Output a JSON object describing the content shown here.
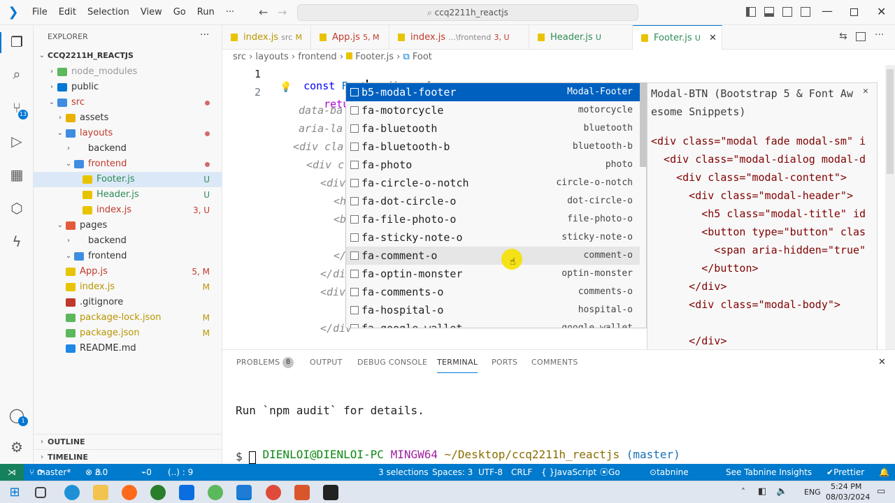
{
  "titlebar": {
    "menus": [
      "File",
      "Edit",
      "Selection",
      "View",
      "Go",
      "Run",
      "···"
    ],
    "search": "ccq2211h_reactjs"
  },
  "activity": {
    "source_control_badge": "13",
    "accounts_badge": "1"
  },
  "sidebar": {
    "header": "EXPLORER",
    "more": "···",
    "root": "CCQ2211H_REACTJS",
    "items": [
      {
        "label": "node_modules",
        "status": ""
      },
      {
        "label": "public",
        "status": ""
      },
      {
        "label": "src",
        "status": ""
      },
      {
        "label": "assets",
        "status": ""
      },
      {
        "label": "layouts",
        "status": ""
      },
      {
        "label": "backend",
        "status": ""
      },
      {
        "label": "frontend",
        "status": ""
      },
      {
        "label": "Footer.js",
        "status": "U"
      },
      {
        "label": "Header.js",
        "status": "U"
      },
      {
        "label": "index.js",
        "status": "3, U"
      },
      {
        "label": "pages",
        "status": ""
      },
      {
        "label": "backend",
        "status": ""
      },
      {
        "label": "frontend",
        "status": ""
      },
      {
        "label": "App.js",
        "status": "5, M"
      },
      {
        "label": "index.js",
        "status": "M"
      },
      {
        "label": ".gitignore",
        "status": ""
      },
      {
        "label": "package-lock.json",
        "status": "M"
      },
      {
        "label": "package.json",
        "status": "M"
      },
      {
        "label": "README.md",
        "status": ""
      }
    ],
    "outline": "OUTLINE",
    "timeline": "TIMELINE"
  },
  "tabs": [
    {
      "name": "index.js",
      "desc": "src",
      "status": "M"
    },
    {
      "name": "App.js",
      "desc": "",
      "status": "5, M"
    },
    {
      "name": "index.js",
      "desc": "...\\frontend",
      "status": "3, U"
    },
    {
      "name": "Header.js",
      "desc": "",
      "status": "U"
    },
    {
      "name": "Footer.js",
      "desc": "",
      "status": "U"
    }
  ],
  "breadcrumbs": [
    "src",
    "layouts",
    "frontend",
    "Footer.js",
    "Foot"
  ],
  "editor": {
    "line1_no": "1",
    "line2_no": "2",
    "line1_const": "const",
    "line1_name": "Foot",
    "line1_rest": " = () => {",
    "line2": "return",
    "ghost": [
      "data-ba",
      "aria-la",
      "<div cla",
      "<div c",
      "<div",
      "<h",
      "<b",
      "</",
      "</di",
      "<div",
      "</div"
    ]
  },
  "suggest": [
    {
      "name": "b5-modal-footer",
      "detail": "Modal-Footer"
    },
    {
      "name": "fa-motorcycle",
      "detail": "motorcycle"
    },
    {
      "name": "fa-bluetooth",
      "detail": "bluetooth"
    },
    {
      "name": "fa-bluetooth-b",
      "detail": "bluetooth-b"
    },
    {
      "name": "fa-photo",
      "detail": "photo"
    },
    {
      "name": "fa-circle-o-notch",
      "detail": "circle-o-notch"
    },
    {
      "name": "fa-dot-circle-o",
      "detail": "dot-circle-o"
    },
    {
      "name": "fa-file-photo-o",
      "detail": "file-photo-o"
    },
    {
      "name": "fa-sticky-note-o",
      "detail": "sticky-note-o"
    },
    {
      "name": "fa-comment-o",
      "detail": "comment-o"
    },
    {
      "name": "fa-optin-monster",
      "detail": "optin-monster"
    },
    {
      "name": "fa-comments-o",
      "detail": "comments-o"
    },
    {
      "name": "fa-hospital-o",
      "detail": "hospital-o"
    },
    {
      "name": "fa-google-wallet",
      "detail": "google-wallet"
    }
  ],
  "detail": {
    "title1": "Modal-BTN (Bootstrap 5 & Font Aw",
    "title2": "esome Snippets)",
    "lines": [
      "<div class=\"modal fade modal-sm\" i",
      "  <div class=\"modal-dialog modal-d",
      "    <div class=\"modal-content\">",
      "      <div class=\"modal-header\">",
      "        <h5 class=\"modal-title\" id",
      "        <button type=\"button\" clas",
      "          <span aria-hidden=\"true\"",
      "        </button>",
      "      </div>",
      "      <div class=\"modal-body\">",
      "",
      "      </div>",
      "",
      "    </div>",
      "  </div>",
      "</div>"
    ]
  },
  "panel": {
    "tabs": [
      "PROBLEMS",
      "OUTPUT",
      "DEBUG CONSOLE",
      "TERMINAL",
      "PORTS",
      "COMMENTS"
    ],
    "problems_count": "8",
    "terminal_line1": "Run `npm audit` for details.",
    "prompt_user": "DIENLOI@DIENLOI-PC",
    "prompt_env": "MINGW64",
    "prompt_path": "~/Desktop/ccq2211h_reactjs",
    "prompt_branch": "(master)",
    "prompt_symbol": "$"
  },
  "status": {
    "branch": "master*",
    "errors": "8",
    "warnings": "0",
    "ports": "0",
    "pos": "(..) : 9",
    "selections": "3 selections",
    "spaces": "Spaces: 3",
    "encoding": "UTF-8",
    "eol": "CRLF",
    "language": "JavaScript",
    "golive": "Go Live",
    "tabnine": "tabnine starter",
    "insights": "See Tabnine Insights",
    "prettier": "Prettier"
  },
  "taskbar": {
    "time": "5:24 PM",
    "date": "08/03/2024",
    "lang": "ENG"
  },
  "colors": {
    "accent": "#007acc",
    "selection": "#0060c0",
    "modified": "#b89500",
    "untracked": "#2e8b57"
  }
}
